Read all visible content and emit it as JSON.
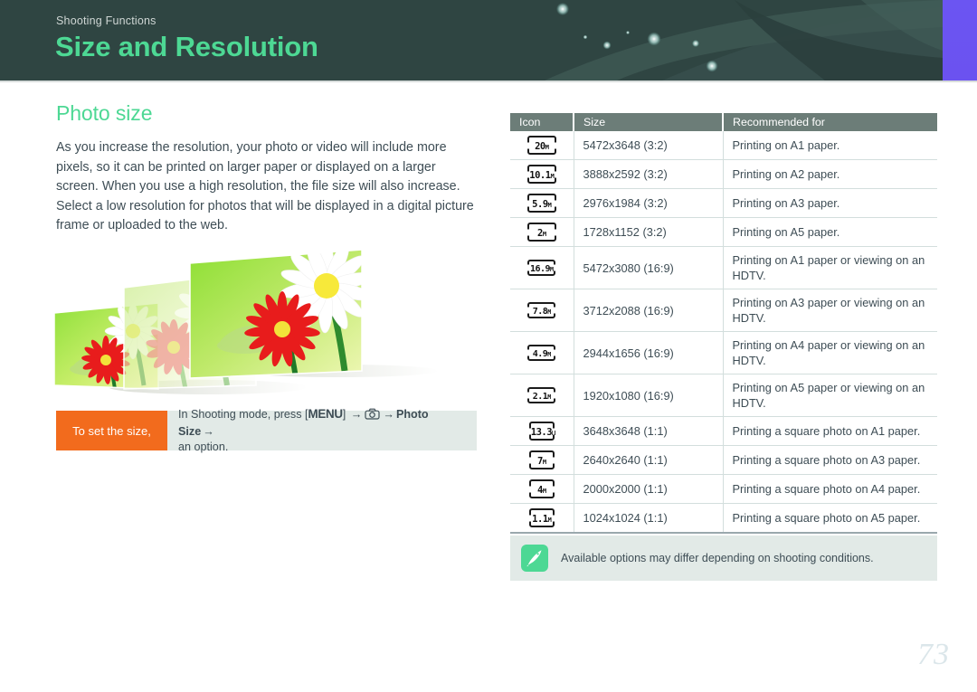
{
  "header": {
    "breadcrumb": "Shooting Functions",
    "title": "Size and Resolution"
  },
  "left": {
    "section_title": "Photo size",
    "body": "As you increase the resolution, your photo or video will include more pixels, so it can be printed on larger paper or displayed on a larger screen. When you use a high resolution, the file size will also increase. Select a low resolution for photos that will be displayed in a digital picture frame or uploaded to the web."
  },
  "callout": {
    "tag": "To set the size,",
    "prefix": "In Shooting mode, press [",
    "menu_key": "MENU",
    "after_key": "] ",
    "arrow": "→",
    "camera_icon": "camera-icon",
    "photo_size": "Photo Size",
    "suffix": "an option."
  },
  "table": {
    "columns": [
      "Icon",
      "Size",
      "Recommended for"
    ],
    "rows": [
      {
        "icon_label": "20",
        "icon_unit": "M",
        "icon_shape": "r32",
        "size": "5472x3648 (3:2)",
        "recommended": "Printing on A1 paper."
      },
      {
        "icon_label": "10.1",
        "icon_unit": "M",
        "icon_shape": "r32",
        "size": "3888x2592 (3:2)",
        "recommended": "Printing on A2 paper."
      },
      {
        "icon_label": "5.9",
        "icon_unit": "M",
        "icon_shape": "r32",
        "size": "2976x1984 (3:2)",
        "recommended": "Printing on A3 paper."
      },
      {
        "icon_label": "2",
        "icon_unit": "M",
        "icon_shape": "r32",
        "size": "1728x1152 (3:2)",
        "recommended": "Printing on A5 paper."
      },
      {
        "icon_label": "16.9",
        "icon_unit": "M",
        "icon_shape": "r169",
        "size": "5472x3080 (16:9)",
        "recommended": "Printing on A1 paper or viewing on an HDTV."
      },
      {
        "icon_label": "7.8",
        "icon_unit": "M",
        "icon_shape": "r169",
        "size": "3712x2088 (16:9)",
        "recommended": "Printing on A3 paper or viewing on an HDTV."
      },
      {
        "icon_label": "4.9",
        "icon_unit": "M",
        "icon_shape": "r169",
        "size": "2944x1656 (16:9)",
        "recommended": "Printing on A4 paper or viewing on an HDTV."
      },
      {
        "icon_label": "2.1",
        "icon_unit": "M",
        "icon_shape": "r169",
        "size": "1920x1080 (16:9)",
        "recommended": "Printing on A5 paper or viewing on an HDTV."
      },
      {
        "icon_label": "13.3",
        "icon_unit": "M",
        "icon_shape": "r11",
        "size": "3648x3648 (1:1)",
        "recommended": "Printing a square photo on A1 paper."
      },
      {
        "icon_label": "7",
        "icon_unit": "M",
        "icon_shape": "r11",
        "size": "2640x2640 (1:1)",
        "recommended": "Printing a square photo on A3 paper."
      },
      {
        "icon_label": "4",
        "icon_unit": "M",
        "icon_shape": "r11",
        "size": "2000x2000 (1:1)",
        "recommended": "Printing a square photo on A4 paper."
      },
      {
        "icon_label": "1.1",
        "icon_unit": "M",
        "icon_shape": "r11",
        "size": "1024x1024 (1:1)",
        "recommended": "Printing a square photo on A5 paper."
      }
    ]
  },
  "note": {
    "icon": "pen-note-icon",
    "text": "Available options may differ depending on shooting conditions."
  },
  "page_number": "73",
  "colors": {
    "header_bg": "#2f4542",
    "accent_green": "#4dd894",
    "table_header_bg": "#6c7d78",
    "callout_orange": "#f26b1d",
    "note_bg": "#e2eae7",
    "body_text": "#3e4d55",
    "purple_band": "#6b55f2"
  }
}
